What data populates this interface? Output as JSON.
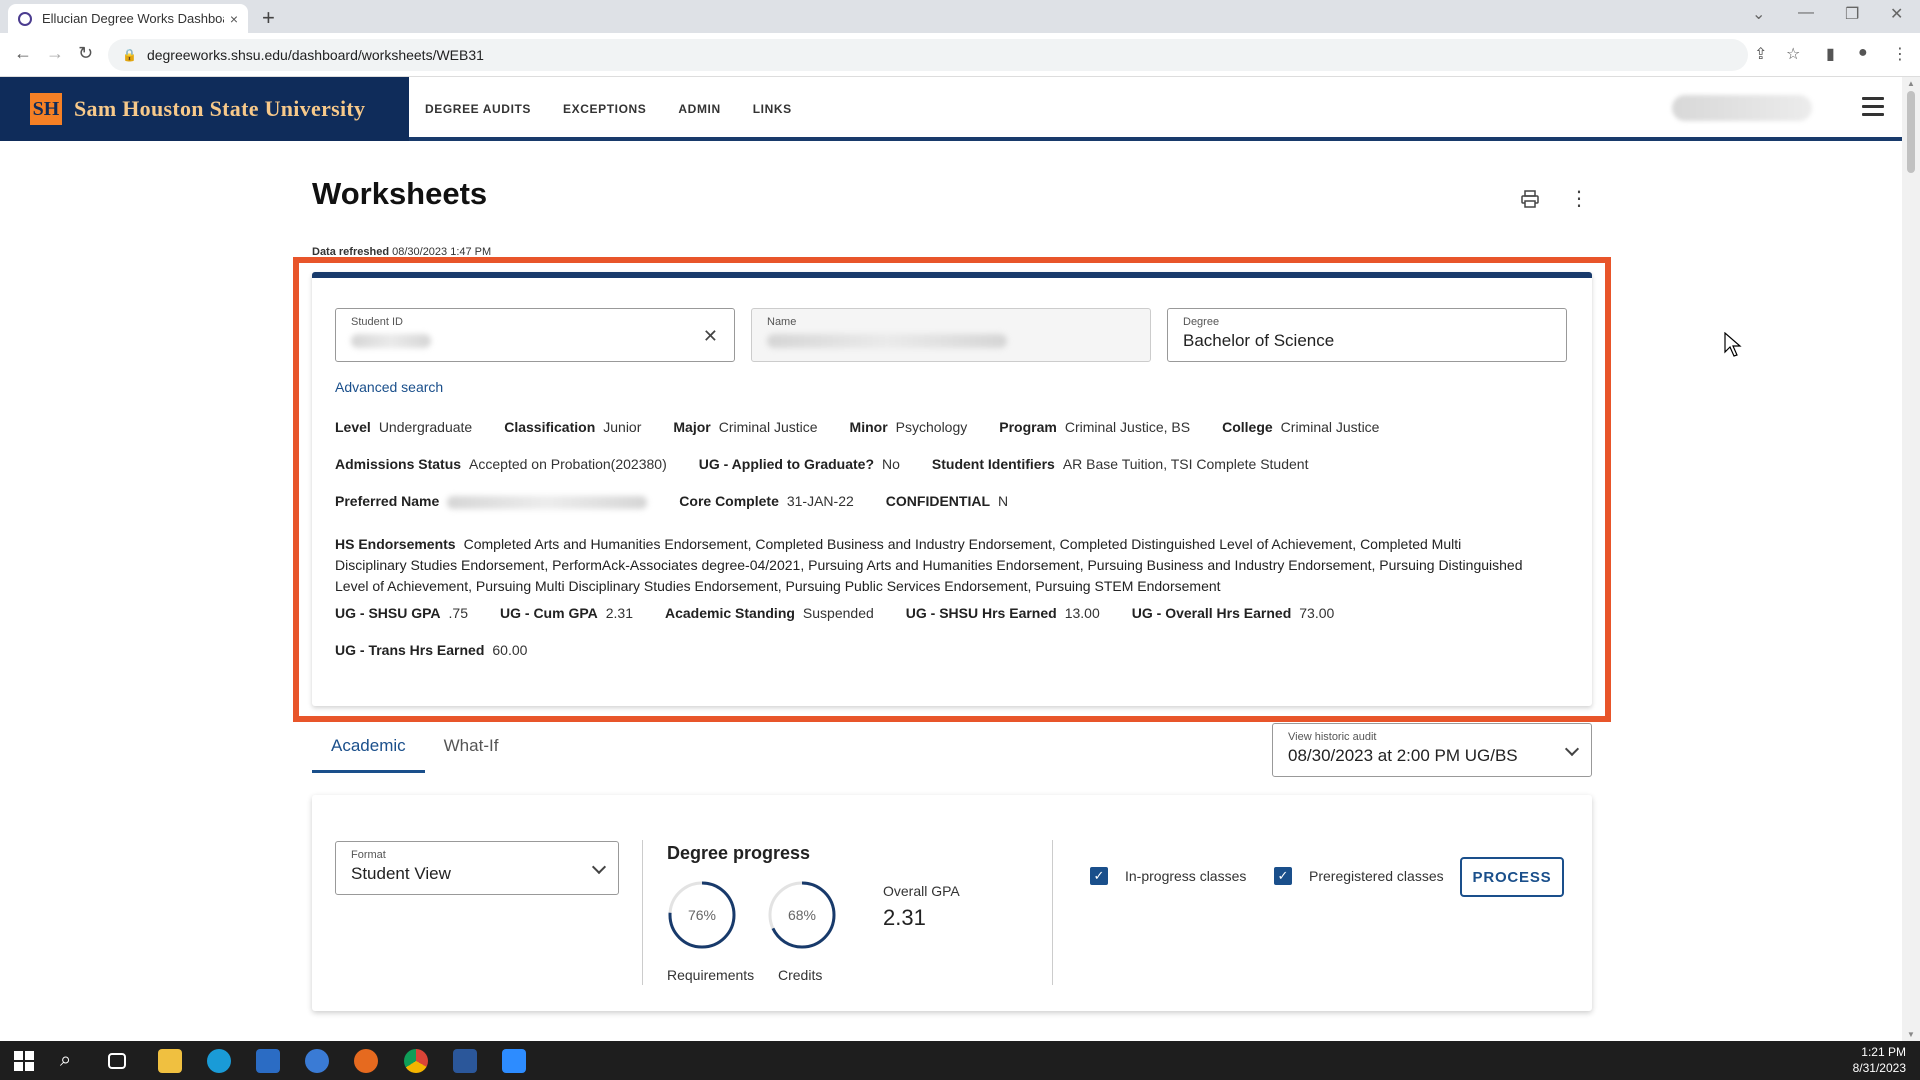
{
  "browser": {
    "tab_title": "Ellucian Degree Works Dashboar",
    "tab_close": "×",
    "new_tab": "+",
    "url": "degreeworks.shsu.edu/dashboard/worksheets/WEB31"
  },
  "header": {
    "university": "Sam Houston State University",
    "logo_letters": "SH",
    "nav": [
      "DEGREE AUDITS",
      "EXCEPTIONS",
      "ADMIN",
      "LINKS"
    ]
  },
  "page": {
    "title": "Worksheets",
    "refreshed_label": "Data refreshed",
    "refreshed_value": "08/30/2023 1:47 PM"
  },
  "student": {
    "id_label": "Student ID",
    "name_label": "Name",
    "degree_label": "Degree",
    "degree_value": "Bachelor of Science",
    "advanced_search": "Advanced search",
    "row1": [
      {
        "k": "Level",
        "v": "Undergraduate"
      },
      {
        "k": "Classification",
        "v": "Junior"
      },
      {
        "k": "Major",
        "v": "Criminal Justice"
      },
      {
        "k": "Minor",
        "v": "Psychology"
      },
      {
        "k": "Program",
        "v": "Criminal Justice, BS"
      },
      {
        "k": "College",
        "v": "Criminal Justice"
      }
    ],
    "row2": [
      {
        "k": "Admissions Status",
        "v": "Accepted on Probation(202380)"
      },
      {
        "k": "UG - Applied to Graduate?",
        "v": "No"
      },
      {
        "k": "Student Identifiers",
        "v": "AR Base Tuition, TSI Complete Student"
      }
    ],
    "row3": {
      "preferred_name_label": "Preferred Name",
      "core_label": "Core Complete",
      "core_value": "31-JAN-22",
      "conf_label": "CONFIDENTIAL",
      "conf_value": "N"
    },
    "hs_label": "HS Endorsements",
    "hs_value": "Completed Arts and Humanities Endorsement, Completed Business and Industry Endorsement, Completed Distinguished Level of Achievement, Completed Multi Disciplinary Studies Endorsement, PerformAck-Associates degree-04/2021, Pursuing Arts and Humanities Endorsement, Pursuing Business and Industry Endorsement, Pursuing Distinguished Level of Achievement, Pursuing Multi Disciplinary Studies Endorsement, Pursuing Public Services Endorsement, Pursuing STEM Endorsement",
    "row5": [
      {
        "k": "UG - SHSU GPA",
        "v": ".75"
      },
      {
        "k": "UG - Cum GPA",
        "v": "2.31"
      },
      {
        "k": "Academic Standing",
        "v": "Suspended"
      },
      {
        "k": "UG - SHSU Hrs Earned",
        "v": "13.00"
      },
      {
        "k": "UG - Overall Hrs Earned",
        "v": "73.00"
      }
    ],
    "row6": [
      {
        "k": "UG - Trans Hrs Earned",
        "v": "60.00"
      }
    ]
  },
  "tabs": [
    "Academic",
    "What-If"
  ],
  "historic": {
    "label": "View historic audit",
    "value": "08/30/2023 at 2:00 PM UG/BS"
  },
  "progress": {
    "format_label": "Format",
    "format_value": "Student View",
    "title": "Degree progress",
    "requirements_pct": 76,
    "requirements_text": "76%",
    "requirements_label": "Requirements",
    "credits_pct": 68,
    "credits_text": "68%",
    "credits_label": "Credits",
    "gpa_label": "Overall GPA",
    "gpa_value": "2.31",
    "inprogress_label": "In-progress classes",
    "preregistered_label": "Preregistered classes",
    "process_label": "PROCESS"
  },
  "taskbar": {
    "time": "1:21 PM",
    "date": "8/31/2023"
  },
  "colors": {
    "navy": "#0f2c5a",
    "accent_blue": "#1a4f8b",
    "highlight": "#e8552a",
    "gold": "#f7c98a"
  }
}
